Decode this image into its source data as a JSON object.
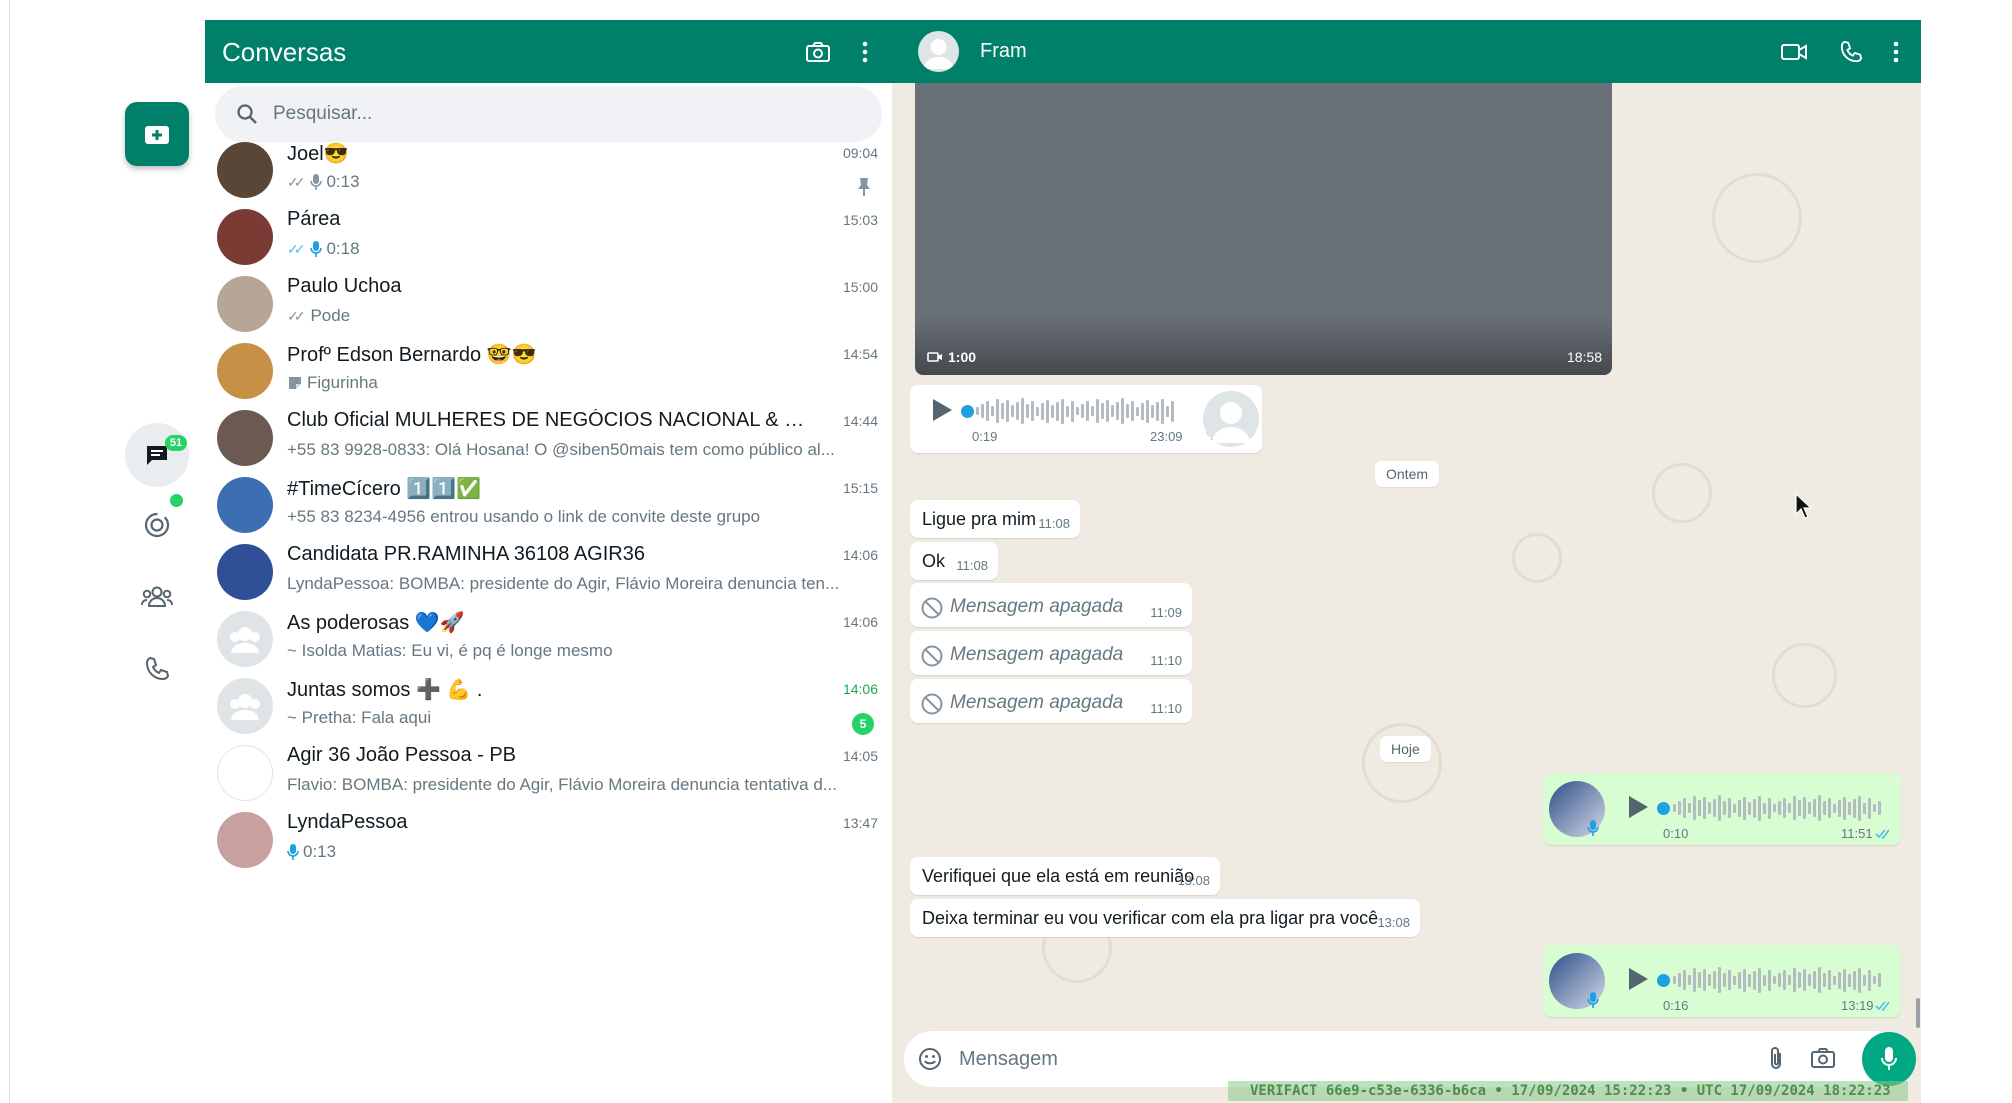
{
  "app": {
    "left_title": "Conversas",
    "search_placeholder": "Pesquisar...",
    "rail_badge": "51"
  },
  "colors": {
    "brand": "#008069",
    "accent": "#25d366",
    "bubble_out": "#d9fdd3",
    "chat_bg": "#efeae2"
  },
  "chats": [
    {
      "name": "Joel😎",
      "time": "09:04",
      "preview": "0:13",
      "preview_icon": "mic-icon",
      "ticks": "✓✓",
      "ticks_color": "#8696a0",
      "pinned": true,
      "avatar": "#5a4636"
    },
    {
      "name": "Párea",
      "time": "15:03",
      "preview": "0:18",
      "preview_icon": "mic-icon",
      "ticks": "✓✓",
      "ticks_color": "#53bdeb",
      "avatar": "#7a3b34"
    },
    {
      "name": "Paulo Uchoa",
      "time": "15:00",
      "preview": "Pode",
      "ticks": "✓✓",
      "ticks_color": "#8696a0",
      "avatar": "#b7a695"
    },
    {
      "name": "Profº Edson Bernardo 🤓😎",
      "time": "14:54",
      "preview": "Figurinha",
      "preview_icon": "sticker-icon",
      "avatar": "#c69146"
    },
    {
      "name": "Club Oficial MULHERES DE NEGÓCIOS NACIONAL & INT...",
      "time": "14:44",
      "preview": "+55 83 9928-0833: Olá Hosana! O @siben50mais tem como público al...",
      "avatar": "#6c5a52"
    },
    {
      "name": "#TimeCícero 1️⃣1️⃣✅",
      "time": "15:15",
      "preview": "+55 83 8234-4956 entrou usando o link de convite deste grupo",
      "avatar": "#3b6fb2"
    },
    {
      "name": "Candidata PR.RAMINHA 36108 AGIR36",
      "time": "14:06",
      "preview": "LyndaPessoa:  BOMBA: presidente do Agir, Flávio Moreira denuncia ten...",
      "avatar": "#2f4f96"
    },
    {
      "name": "As poderosas 💙🚀",
      "time": "14:06",
      "preview": "~ Isolda Matias: Eu vi, é pq é longe mesmo",
      "avatar": "#dfe5e7",
      "group": true
    },
    {
      "name": "Juntas somos ➕ 💪 .",
      "time": "14:06",
      "time_green": true,
      "preview": "~ Pretha: Fala aqui",
      "unread": "5",
      "avatar": "#dfe5e7",
      "group": true
    },
    {
      "name": "Agir 36 João Pessoa - PB",
      "time": "14:05",
      "preview": "Flavio: BOMBA: presidente do Agir, Flávio Moreira denuncia tentativa d...",
      "avatar": "#ffffff"
    },
    {
      "name": "LyndaPessoa",
      "time": "13:47",
      "preview": "0:13",
      "preview_icon": "mic-icon",
      "avatar": "#c9a0a0"
    }
  ],
  "conversation": {
    "contact_name": "Fram",
    "video": {
      "duration": "1:00",
      "time": "18:58"
    },
    "audio_in": {
      "position": "0:19",
      "time": "23:09"
    },
    "date_yesterday": "Ontem",
    "date_today": "Hoje",
    "messages_yesterday": [
      {
        "text": "Ligue pra mim",
        "time": "11:08"
      },
      {
        "text": "Ok",
        "time": "11:08"
      }
    ],
    "deleted": [
      {
        "text": "Mensagem apagada",
        "time": "11:09"
      },
      {
        "text": "Mensagem apagada",
        "time": "11:10"
      },
      {
        "text": "Mensagem apagada",
        "time": "11:10"
      }
    ],
    "audio_out_1": {
      "duration": "0:10",
      "time": "11:51"
    },
    "messages_today": [
      {
        "text": "Verifiquei que ela está em reunião",
        "time": "13:08"
      },
      {
        "text": "Deixa terminar eu vou verificar com ela pra ligar pra você",
        "time": "13:08"
      }
    ],
    "audio_out_2": {
      "duration": "0:16",
      "time": "13:19"
    },
    "composer_placeholder": "Mensagem",
    "verifact": "VERIFACT 66e9-c53e-6336-b6ca • 17/09/2024 15:22:23 • UTC 17/09/2024 18:22:23"
  }
}
